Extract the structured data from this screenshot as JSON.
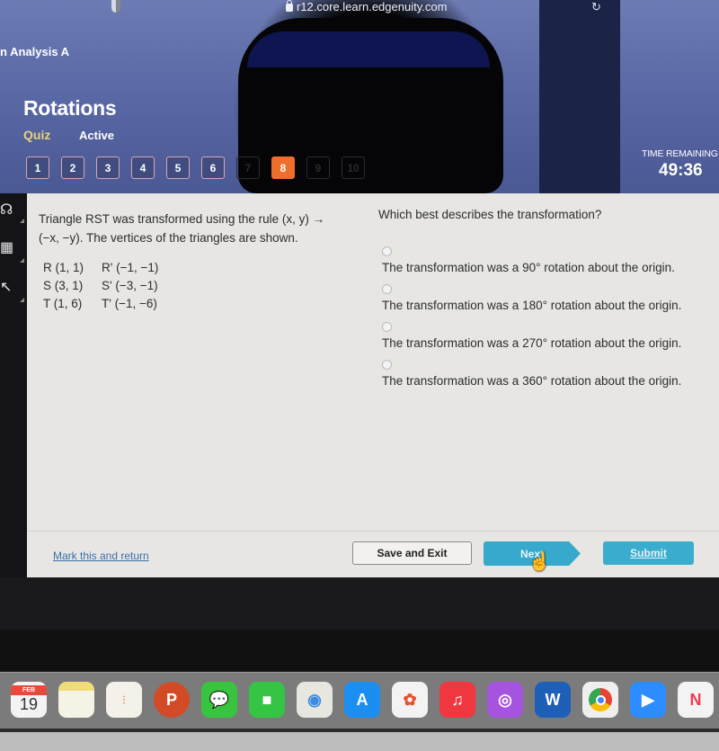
{
  "browser": {
    "url": "r12.core.learn.edgenuity.com"
  },
  "header": {
    "course": "n Analysis A",
    "lesson_title": "Rotations",
    "activity_type": "Quiz",
    "status": "Active",
    "timer_label": "TIME REMAINING",
    "timer_value": "49:36"
  },
  "question_nav": [
    {
      "label": "1",
      "state": "answered"
    },
    {
      "label": "2",
      "state": "answered"
    },
    {
      "label": "3",
      "state": "answered"
    },
    {
      "label": "4",
      "state": "answered"
    },
    {
      "label": "5",
      "state": "answered"
    },
    {
      "label": "6",
      "state": "answered"
    },
    {
      "label": "7",
      "state": "locked"
    },
    {
      "label": "8",
      "state": "current"
    },
    {
      "label": "9",
      "state": "locked"
    },
    {
      "label": "10",
      "state": "locked"
    }
  ],
  "tools": [
    "headphones-icon",
    "calculator-icon",
    "pin-icon"
  ],
  "problem": {
    "prompt": "Triangle RST was transformed using the rule (x, y) → (−x, −y). The vertices of the triangles are shown.",
    "vertices": [
      {
        "original": "R (1, 1)",
        "image": "R' (−1, −1)"
      },
      {
        "original": "S (3, 1)",
        "image": "S' (−3, −1)"
      },
      {
        "original": "T (1, 6)",
        "image": "T' (−1, −6)"
      }
    ],
    "question": "Which best describes the transformation?",
    "options": [
      "The transformation was a 90° rotation about the origin.",
      "The transformation was a 180° rotation about the origin.",
      "The transformation was a 270° rotation about the origin.",
      "The transformation was a 360° rotation about the origin."
    ]
  },
  "footer": {
    "mark_link": "Mark this and return",
    "save_exit": "Save and Exit",
    "next": "Next",
    "submit": "Submit"
  },
  "dock": {
    "calendar_month": "FEB",
    "calendar_day": "19",
    "apps": [
      "calendar",
      "notes",
      "reminders",
      "powerpoint",
      "messages",
      "facetime",
      "maps",
      "app-store",
      "photos",
      "music",
      "podcasts",
      "word",
      "chrome",
      "zoom",
      "news"
    ]
  },
  "colors": {
    "current_question": "#ee6f2c",
    "primary_button": "#37a9cc",
    "link": "#3b6fa8",
    "quiz_label": "#e8d17a"
  }
}
